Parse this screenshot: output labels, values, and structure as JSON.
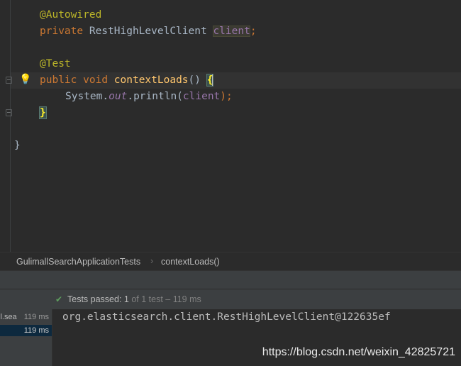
{
  "editor": {
    "lines": {
      "l1": {
        "annotation": "@Autowired"
      },
      "l2": {
        "kw": "private",
        "type": "RestHighLevelClient",
        "field": "client",
        "semi": ";"
      },
      "l4": {
        "annotation": "@Test"
      },
      "l5": {
        "kw1": "public",
        "kw2": "void",
        "method": "contextLoads",
        "parens": "()",
        "brace": "{"
      },
      "l6": {
        "cls": "System",
        "dot1": ".",
        "out": "out",
        "dot2": ".",
        "call": "println",
        "open": "(",
        "arg": "client",
        "close": ");"
      },
      "l7": {
        "brace": "}"
      },
      "l9": {
        "brace": "}"
      }
    },
    "intention_icon": "lightbulb-icon"
  },
  "breadcrumb": {
    "items": [
      "GulimallSearchApplicationTests",
      "contextLoads()"
    ],
    "separator": "›"
  },
  "test_status": {
    "icon": "check-icon",
    "label": "Tests passed: ",
    "passed": "1",
    "rest": " of 1 test – 119 ms"
  },
  "test_tree": {
    "rows": [
      {
        "name": "ll.sea",
        "duration": "119 ms"
      },
      {
        "name": "",
        "duration": "119 ms"
      }
    ]
  },
  "console": {
    "output": "org.elasticsearch.client.RestHighLevelClient@122635ef"
  },
  "watermark": "https://blog.csdn.net/weixin_42825721",
  "colors": {
    "background": "#2b2b2b",
    "annotation": "#bbb529",
    "keyword": "#cc7832",
    "method": "#ffc66d",
    "field": "#9876aa",
    "pass_green": "#5e9f5e"
  }
}
